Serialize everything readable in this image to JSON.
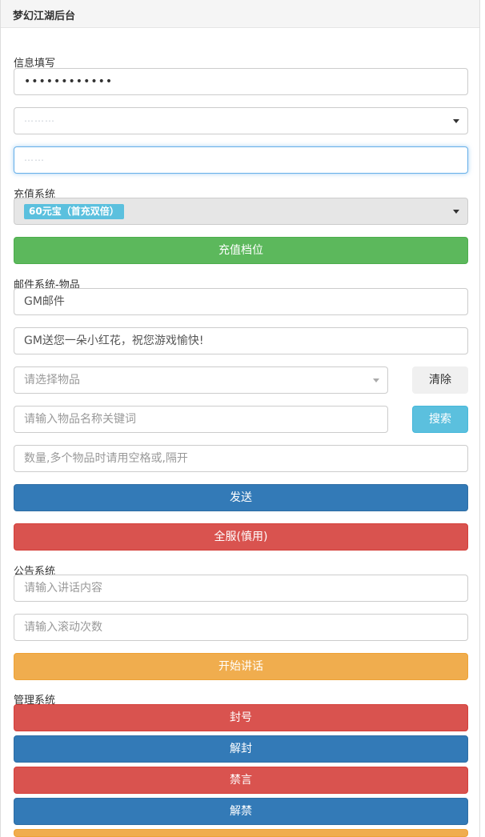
{
  "header": {
    "title": "梦幻江湖后台"
  },
  "info": {
    "label": "信息填写",
    "password_value": "••••••••••••",
    "server_select_value": "⋯⋯⋯",
    "role_value": "⋯⋯"
  },
  "recharge": {
    "label": "充值系统",
    "selected_option": "60元宝（首充双倍）",
    "button": "充值档位"
  },
  "mail": {
    "label": "邮件系统-物品",
    "title_value": "GM邮件",
    "content_value": "GM送您一朵小红花，祝您游戏愉快!",
    "item_select_placeholder": "请选择物品",
    "clear_button": "清除",
    "keyword_placeholder": "请输入物品名称关键词",
    "search_button": "搜索",
    "quantity_placeholder": "数量,多个物品时请用空格或,隔开",
    "send_button": "发送",
    "all_server_button": "全服(慎用)"
  },
  "notice": {
    "label": "公告系统",
    "content_placeholder": "请输入讲话内容",
    "times_placeholder": "请输入滚动次数",
    "start_button": "开始讲话"
  },
  "manage": {
    "label": "管理系统",
    "ban_button": "封号",
    "unban_button": "解封",
    "mute_button": "禁言",
    "unmute_button": "解禁"
  },
  "colors": {
    "success": "#5cb85c",
    "primary": "#337ab7",
    "danger": "#d9534f",
    "warning": "#f0ad4e",
    "info": "#5bc0de"
  }
}
